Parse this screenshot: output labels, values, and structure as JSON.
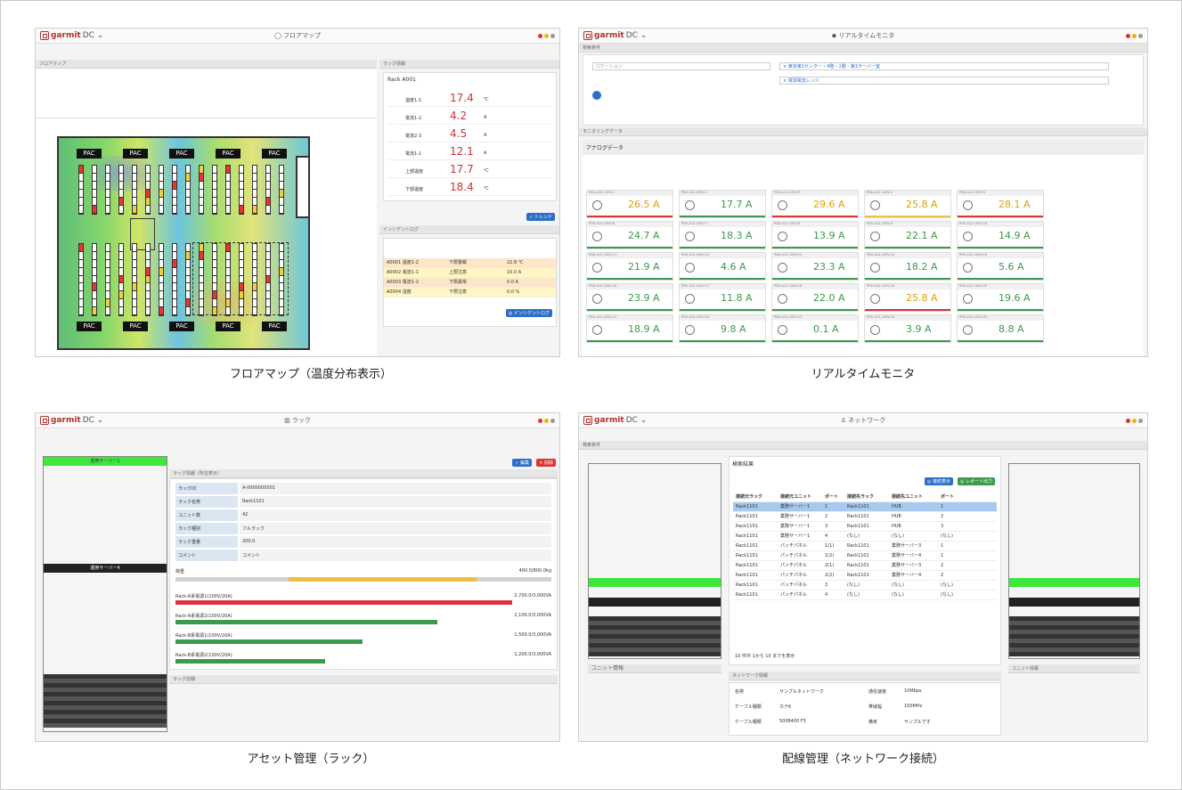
{
  "brand": {
    "name": "garmit",
    "suffix": "DC ⌄"
  },
  "panels": [
    {
      "title": "◯ フロアマップ",
      "caption": "フロアマップ（温度分布表示）"
    },
    {
      "title": "◆ リアルタイムモニタ",
      "caption": "リアルタイムモニタ"
    },
    {
      "title": "▥ ラック",
      "caption": "アセット管理（ラック）"
    },
    {
      "title": "♙ ネットワーク",
      "caption": "配線管理（ネットワーク接続）"
    }
  ],
  "floor": {
    "left_title": "フロアマップ",
    "right_title": "ラック情報",
    "rack_name": "Rack A001",
    "legend": "✓ トレンド",
    "pac": "PAC",
    "readings": [
      {
        "name": "温度1-1",
        "value": "17.4",
        "unit": "℃"
      },
      {
        "name": "電流1-2",
        "value": "4.2",
        "unit": "A"
      },
      {
        "name": "電流2-3",
        "value": "4.5",
        "unit": "A"
      },
      {
        "name": "電流1-1",
        "value": "12.1",
        "unit": "A"
      },
      {
        "name": "上部温度",
        "value": "17.7",
        "unit": "℃"
      },
      {
        "name": "下部温度",
        "value": "18.4",
        "unit": "℃"
      }
    ],
    "log_title": "インシデントログ",
    "log_btn": "◎ インシデントログ",
    "log": [
      {
        "point": "A0001 温度1-2",
        "status": "下限警報",
        "value": "22.8 ℃",
        "color": "#fde6c8"
      },
      {
        "point": "A0002 電流1-1",
        "status": "上限注意",
        "value": "10.0 A",
        "color": "#fff6c4"
      },
      {
        "point": "A0003 電流1-2",
        "status": "下限異常",
        "value": "0.0 A",
        "color": "#fde6c8"
      },
      {
        "point": "A0004 湿度",
        "status": "下限注意",
        "value": "0.0 %",
        "color": "#fff6c4"
      }
    ]
  },
  "monitor": {
    "cond_title": "検索条件",
    "data_title": "モニタリングデータ",
    "analog": "アナログデータ",
    "loc_placeholder": "ロケーション",
    "loc_tag": "× 東京第1センター › 4階 › 1階 › 第1サーバー室",
    "tag2": "× 電源電流レンジ",
    "values": [
      "26.5",
      "17.7",
      "29.6",
      "25.8",
      "28.1",
      "24.7",
      "18.3",
      "13.9",
      "22.1",
      "14.9",
      "21.9",
      "4.6",
      "23.3",
      "18.2",
      "5.6",
      "23.9",
      "11.8",
      "22.0",
      "25.8",
      "19.6",
      "18.9",
      "9.8",
      "0.1",
      "3.9",
      "8.8"
    ],
    "alarm": [
      0,
      2,
      3,
      4,
      18
    ],
    "unit": "A",
    "point_prefix": "PDU-A12-100V"
  },
  "asset": {
    "section": "ラック情報（所在表示）",
    "fields": [
      {
        "label": "ラックID",
        "value": "A-0000000001"
      },
      {
        "label": "ラック名称",
        "value": "Rack1101"
      },
      {
        "label": "ユニット数",
        "value": "42"
      },
      {
        "label": "ラック種別",
        "value": "フルラック"
      },
      {
        "label": "ラック重量",
        "value": "200.0"
      },
      {
        "label": "コメント",
        "value": "コメント"
      }
    ],
    "load_label": "荷重",
    "load_value": "400.0/800.0kg",
    "power": [
      {
        "name": "Rack-A系電源1(100V/20A)",
        "value": "2,700.0/3,000VA",
        "pct": 0.9,
        "color": "#d9363e"
      },
      {
        "name": "Rack-A系電源2(100V/20A)",
        "value": "2,100.0/3,000VA",
        "pct": 0.7,
        "color": "#3a9b4a"
      },
      {
        "name": "Rack-B系電源1(100V/20A)",
        "value": "1,500.0/3,000VA",
        "pct": 0.5,
        "color": "#3a9b4a"
      },
      {
        "name": "Rack-B系電源2(100V/20A)",
        "value": "1,200.0/3,000VA",
        "pct": 0.4,
        "color": "#3a9b4a"
      }
    ],
    "detail_title": "ラック詳細",
    "unit_green": "運用サーバー1",
    "unit_black": "運用サーバー4",
    "btn_edit": "✓ 編集",
    "btn_del": "× 削除"
  },
  "network": {
    "cond_title": "検索条件",
    "result_title": "検索結果",
    "unit_info": "ユニット情報",
    "net_info": "ネットワーク情報",
    "headers": [
      "接続元ラック",
      "接続元ユニット",
      "ポート",
      "接続先ラック",
      "接続先ユニット",
      "ポート"
    ],
    "rows": [
      [
        "Rack1101",
        "業務サーバー1",
        "1",
        "Rack1101",
        "HUB",
        "1"
      ],
      [
        "Rack1101",
        "業務サーバー1",
        "2",
        "Rack1101",
        "HUB",
        "2"
      ],
      [
        "Rack1101",
        "業務サーバー1",
        "3",
        "Rack1101",
        "HUB",
        "3"
      ],
      [
        "Rack1101",
        "業務サーバー1",
        "4",
        "(なし)",
        "(なし)",
        "(なし)"
      ],
      [
        "Rack1101",
        "パッチパネル",
        "1(1)",
        "Rack1101",
        "業務サーバー3",
        "1"
      ],
      [
        "Rack1101",
        "パッチパネル",
        "1(2)",
        "Rack1101",
        "業務サーバー4",
        "1"
      ],
      [
        "Rack1101",
        "パッチパネル",
        "2(1)",
        "Rack1101",
        "業務サーバー3",
        "2"
      ],
      [
        "Rack1101",
        "パッチパネル",
        "2(2)",
        "Rack1101",
        "業務サーバー4",
        "2"
      ],
      [
        "Rack1101",
        "パッチパネル",
        "3",
        "(なし)",
        "(なし)",
        "(なし)"
      ],
      [
        "Rack1101",
        "パッチパネル",
        "4",
        "(なし)",
        "(なし)",
        "(なし)"
      ]
    ],
    "net_fields": [
      [
        "名称",
        "サンプルネットワーク",
        "通信速度",
        "10Mbps"
      ],
      [
        "ケーブル種類",
        "カテ6",
        "帯域幅",
        "100MHz"
      ],
      [
        "ケーブル種類",
        "5008400 F5",
        "備考",
        "サンプルです"
      ]
    ],
    "btn_conn": "◎ 接続表示",
    "btn_report": "◎ レポート出力",
    "paging": "10 件中 1から 10 までを表示"
  }
}
